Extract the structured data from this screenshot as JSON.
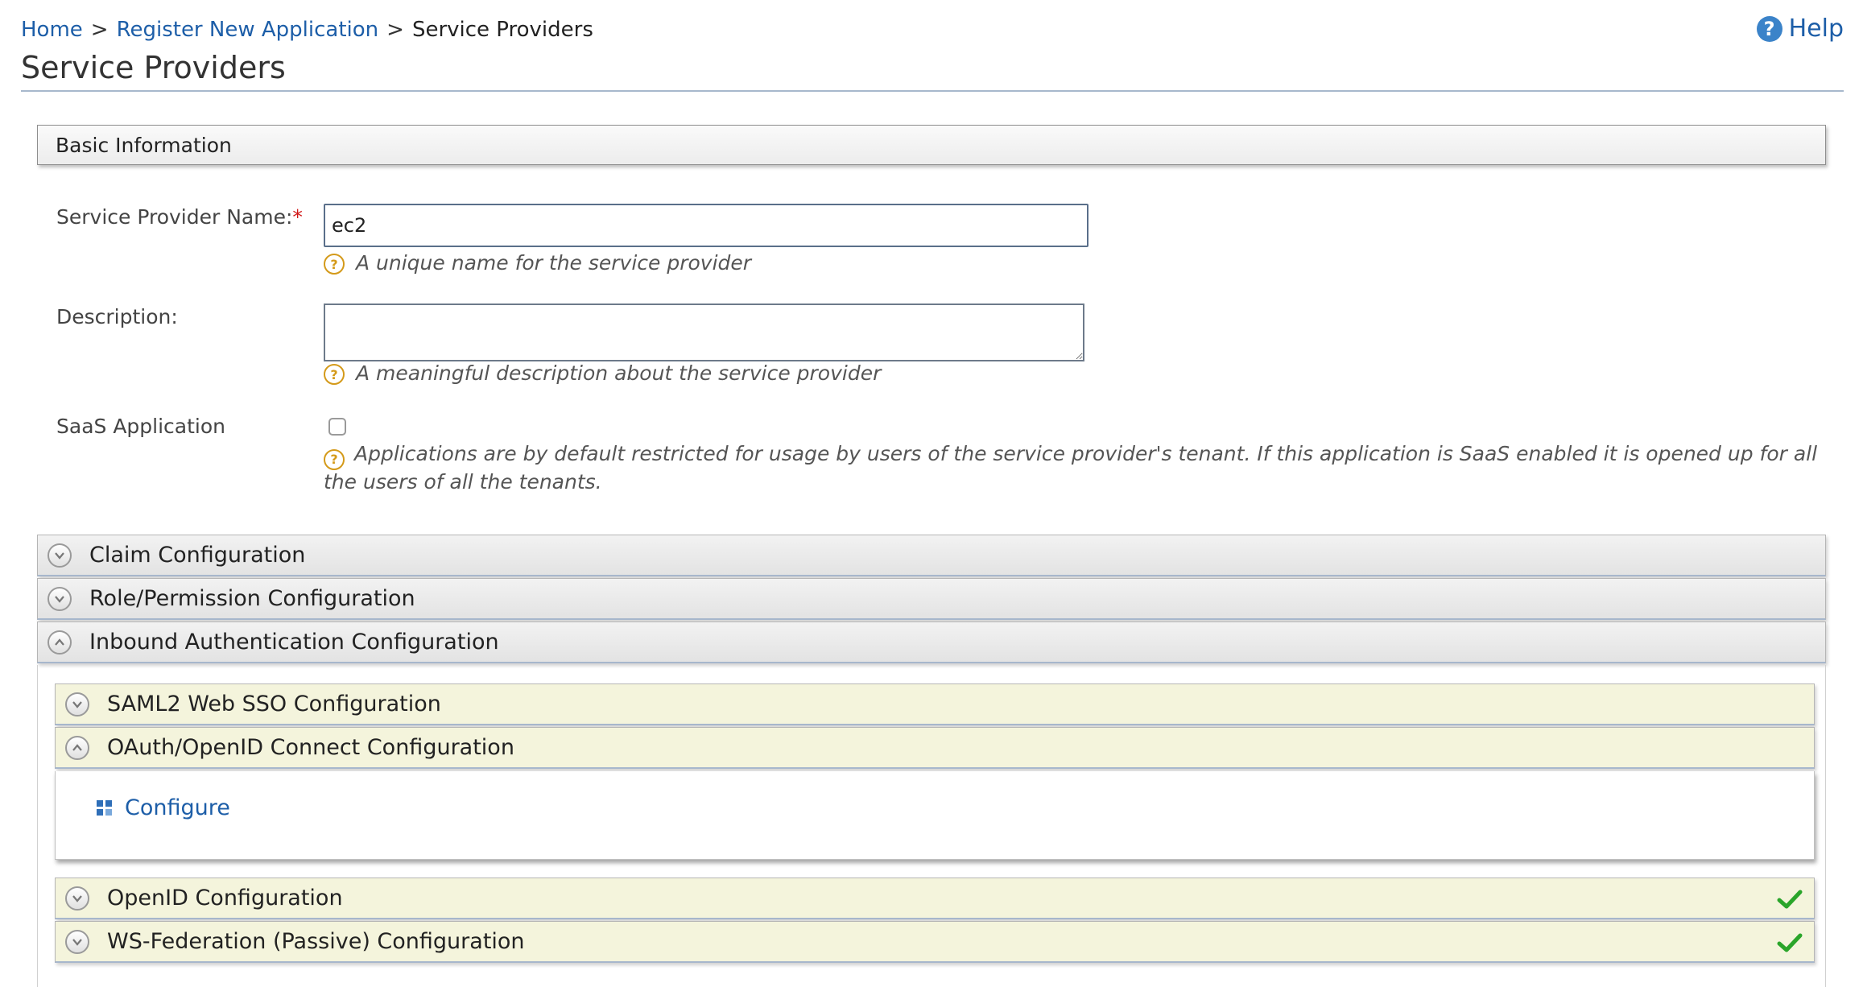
{
  "breadcrumb": {
    "home": "Home",
    "register": "Register New Application",
    "current": "Service Providers",
    "separator": ">"
  },
  "help": {
    "label": "Help"
  },
  "page": {
    "title": "Service Providers"
  },
  "basic_info": {
    "title": "Basic Information"
  },
  "form": {
    "sp_name_label": "Service Provider Name:",
    "required_mark": "*",
    "sp_name_value": "ec2",
    "sp_name_hint": "A unique name for the service provider",
    "description_label": "Description:",
    "description_value": "",
    "description_hint": "A meaningful description about the service provider",
    "saas_label": "SaaS Application",
    "saas_checked": false,
    "saas_hint": "Applications are by default restricted for usage by users of the service provider's tenant. If this application is SaaS enabled it is opened up for all the users of all the tenants."
  },
  "sections": {
    "claim": "Claim Configuration",
    "role": "Role/Permission Configuration",
    "inbound": "Inbound Authentication Configuration"
  },
  "inbound": {
    "saml": "SAML2 Web SSO Configuration",
    "oauth": "OAuth/OpenID Connect Configuration",
    "configure": "Configure",
    "openid": "OpenID Configuration",
    "wsfed": "WS-Federation (Passive) Configuration"
  },
  "colors": {
    "link": "#1d5ea8",
    "required": "#d01818",
    "hint_icon": "#d49a1a",
    "yellow_bar": "#f4f4dc",
    "check": "#2aa52a"
  }
}
